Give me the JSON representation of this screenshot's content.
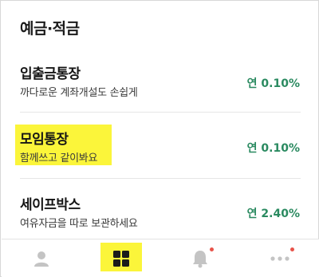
{
  "section": {
    "title": "예금·적금"
  },
  "products": [
    {
      "name": "입출금통장",
      "desc": "까다로운 계좌개설도 손쉽게",
      "rate": "연 0.10%"
    },
    {
      "name": "모임통장",
      "desc": "함께쓰고 같이봐요",
      "rate": "연 0.10%"
    },
    {
      "name": "세이프박스",
      "desc": "여유자금을 따로 보관하세요",
      "rate": "연 2.40%"
    }
  ],
  "tabbar": {
    "tabs": [
      {
        "icon": "person-icon",
        "badge": false
      },
      {
        "icon": "grid-icon",
        "badge": false,
        "active": true
      },
      {
        "icon": "bell-icon",
        "badge": true
      },
      {
        "icon": "more-icon",
        "badge": true
      }
    ]
  },
  "colors": {
    "accent_highlight": "#fbf53a",
    "rate_green": "#2a8a60",
    "badge_red": "#e8534a"
  }
}
